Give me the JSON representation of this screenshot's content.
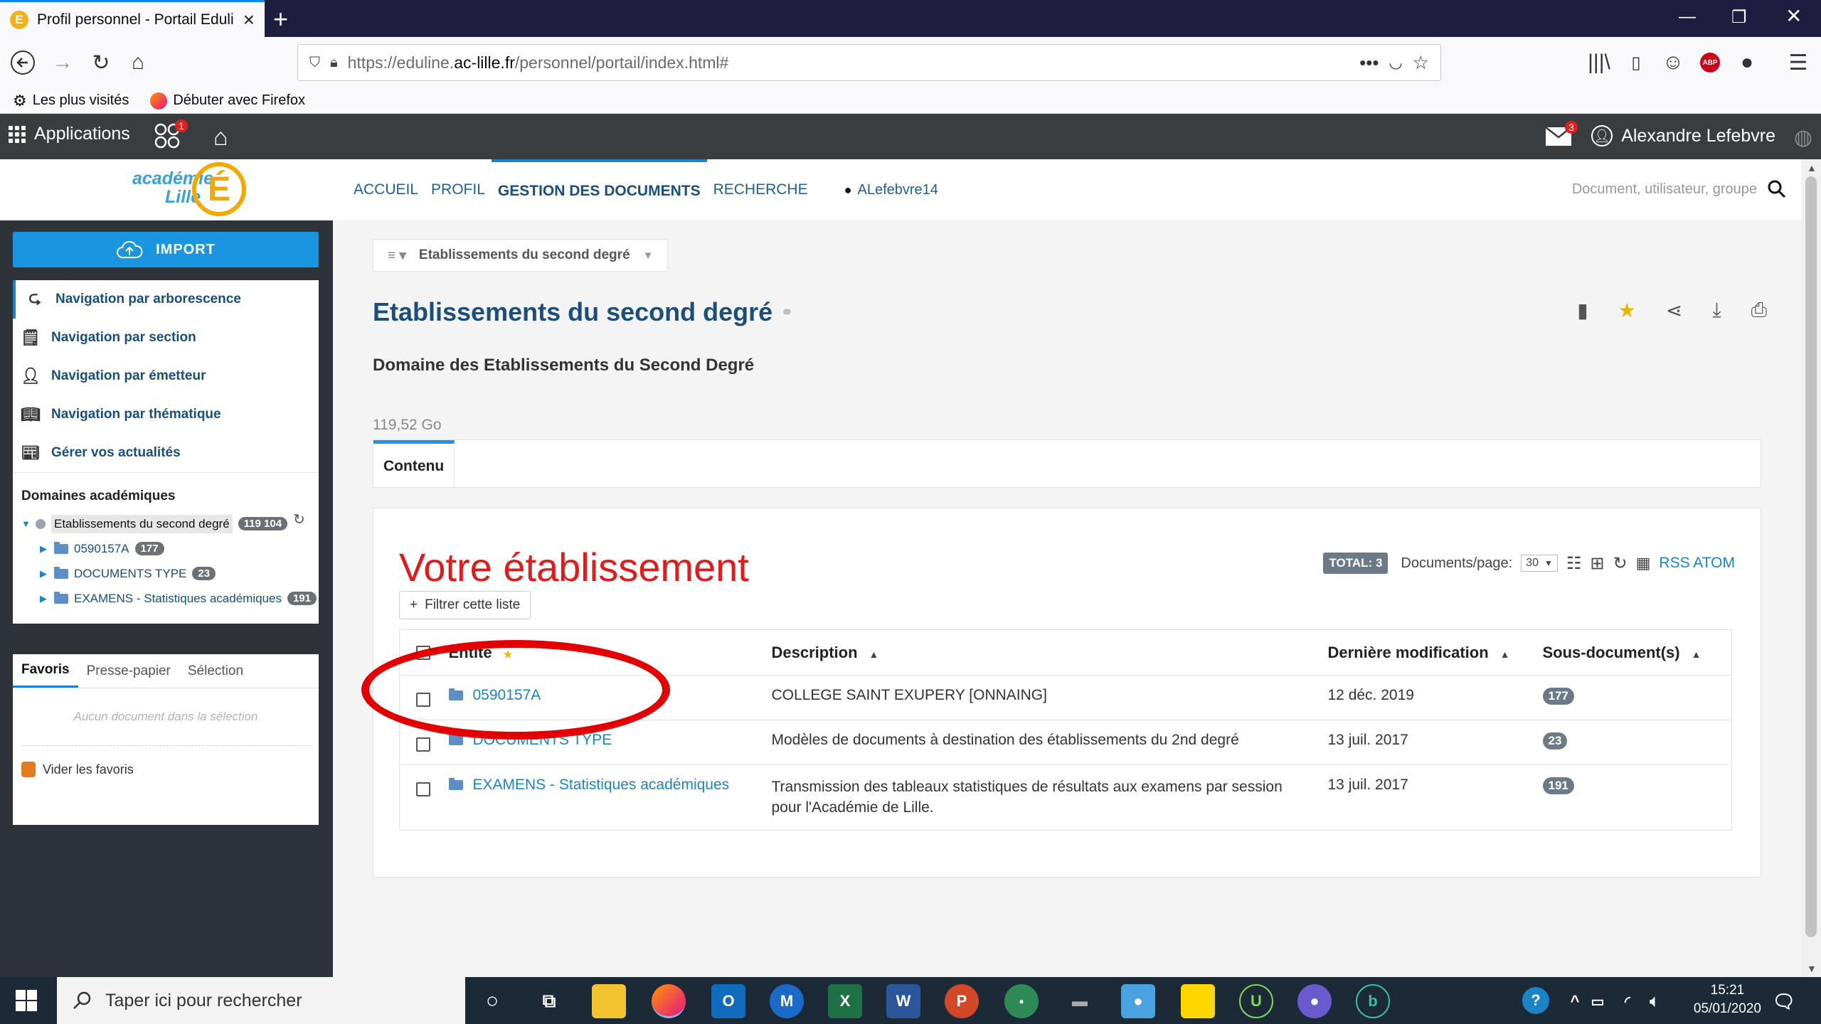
{
  "browser": {
    "tab_title": "Profil personnel - Portail Eduline",
    "url_prefix": "https://eduline.",
    "url_domain": "ac-lille.fr",
    "url_path": "/personnel/portail/index.html#",
    "bookmarks": [
      "Les plus visités",
      "Débuter avec Firefox"
    ]
  },
  "portal_bar": {
    "apps_label": "Applications",
    "apps_badge": "1",
    "mail_badge": "3",
    "user_name": "Alexandre Lefebvre"
  },
  "site_header": {
    "logo_text_1": "académie",
    "logo_text_2": "Lille",
    "logo_letter": "É",
    "nav": [
      "ACCUEIL",
      "PROFIL",
      "GESTION DES DOCUMENTS",
      "RECHERCHE"
    ],
    "active_nav": "GESTION DES DOCUMENTS",
    "username": "ALefebvre14",
    "search_placeholder": "Document, utilisateur, groupe"
  },
  "sidebar": {
    "import_label": "IMPORT",
    "nav_items": [
      "Navigation par arborescence",
      "Navigation par section",
      "Navigation par émetteur",
      "Navigation par thématique",
      "Gérer vos actualités"
    ],
    "domains_title": "Domaines académiques",
    "tree_root": {
      "label": "Etablissements du second degré",
      "count": "119 104"
    },
    "tree_children": [
      {
        "label": "0590157A",
        "count": "177"
      },
      {
        "label": "DOCUMENTS TYPE",
        "count": "23"
      },
      {
        "label": "EXAMENS - Statistiques académiques",
        "count": "191"
      }
    ],
    "fav_tabs": [
      "Favoris",
      "Presse-papier",
      "Sélection"
    ],
    "fav_empty": "Aucun document dans la sélection",
    "fav_clear": "Vider les favoris"
  },
  "main": {
    "breadcrumb": "Etablissements du second degré",
    "title": "Etablissements du second degré",
    "subtitle": "Domaine des Etablissements du Second Degré",
    "size": "119,52 Go",
    "tab": "Contenu",
    "handwritten_title": "Votre établissement",
    "filter_label": "Filtrer cette liste",
    "total_label": "TOTAL: 3",
    "per_page_label": "Documents/page:",
    "per_page_value": "30",
    "rss_label": "RSS ATOM",
    "columns": [
      "Entité",
      "Description",
      "Dernière modification",
      "Sous-document(s)"
    ],
    "rows": [
      {
        "name": "0590157A",
        "description": "COLLEGE SAINT EXUPERY [ONNAING]",
        "modified": "12 déc. 2019",
        "count": "177"
      },
      {
        "name": "DOCUMENTS TYPE",
        "description": "Modèles de documents à destination des établissements du 2nd degré",
        "modified": "13 juil. 2017",
        "count": "23"
      },
      {
        "name": "EXAMENS - Statistiques académiques",
        "description": "Transmission des tableaux statistiques de résultats aux examens par session pour l'Académie de Lille.",
        "modified": "13 juil. 2017",
        "count": "191"
      }
    ]
  },
  "taskbar": {
    "search_placeholder": "Taper ici pour rechercher",
    "time": "15:21",
    "date": "05/01/2020"
  },
  "colors": {
    "accent": "#1a95e0",
    "link": "#1a4e7c",
    "annotation_red": "#e30000"
  }
}
